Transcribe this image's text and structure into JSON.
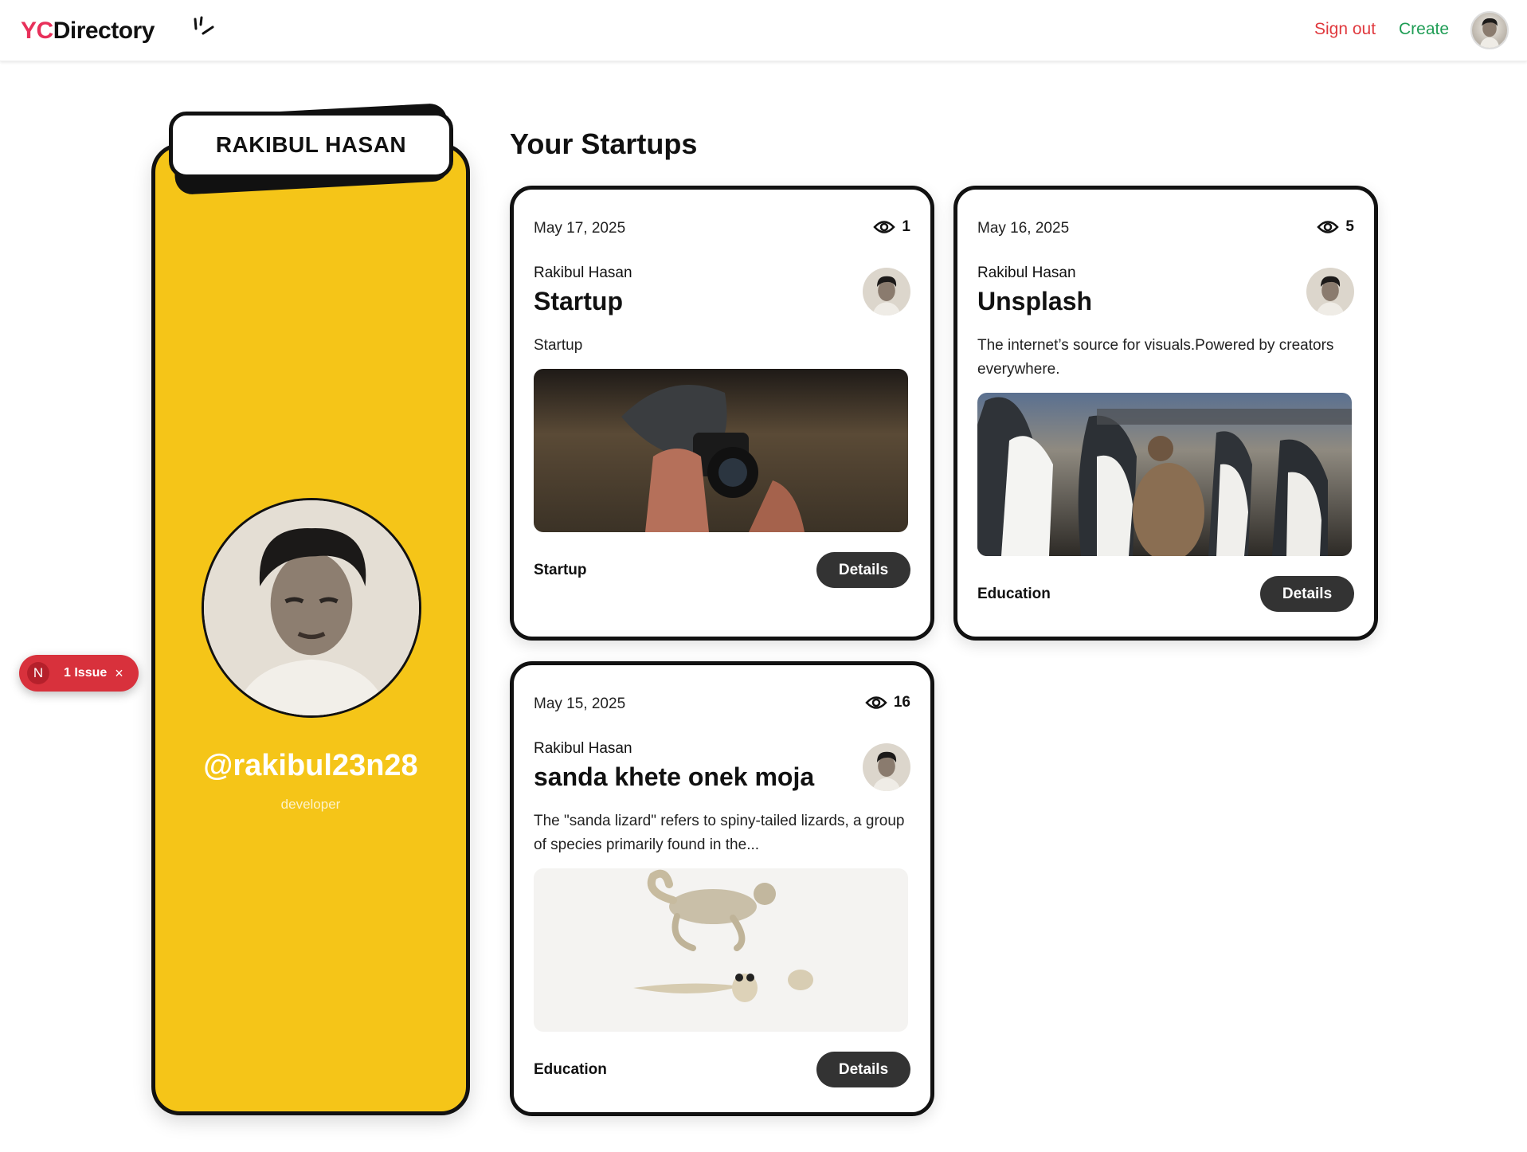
{
  "header": {
    "logo_yc": "YC",
    "logo_directory": "Directory",
    "signout_label": "Sign out",
    "create_label": "Create"
  },
  "profile": {
    "name": "RAKIBUL HASAN",
    "username": "@rakibul23n28",
    "bio": "developer"
  },
  "issue_badge": {
    "letter": "N",
    "label": "1 Issue",
    "close": "×"
  },
  "startups_title": "Your Startups",
  "startups": [
    {
      "date": "May 17, 2025",
      "views": "1",
      "author": "Rakibul Hasan",
      "title": "Startup",
      "description": "Startup",
      "category": "Startup",
      "button": "Details"
    },
    {
      "date": "May 16, 2025",
      "views": "5",
      "author": "Rakibul Hasan",
      "title": "Unsplash",
      "description": "The internet’s source for visuals.Powered by creators everywhere.",
      "category": "Education",
      "button": "Details"
    },
    {
      "date": "May 15, 2025",
      "views": "16",
      "author": "Rakibul Hasan",
      "title": "sanda khete onek moja",
      "description": "The \"sanda lizard\" refers to spiny-tailed lizards, a group of species primarily found in the...",
      "category": "Education",
      "button": "Details"
    }
  ],
  "icons": {
    "views": "eye-icon",
    "logo_mark": "spark-icon",
    "close": "close-icon"
  },
  "colors": {
    "brand_pink": "#e8305a",
    "profile_yellow": "#f5c518",
    "signout_red": "#e0393e",
    "create_green": "#1f9d55",
    "issue_red": "#d8313c"
  }
}
